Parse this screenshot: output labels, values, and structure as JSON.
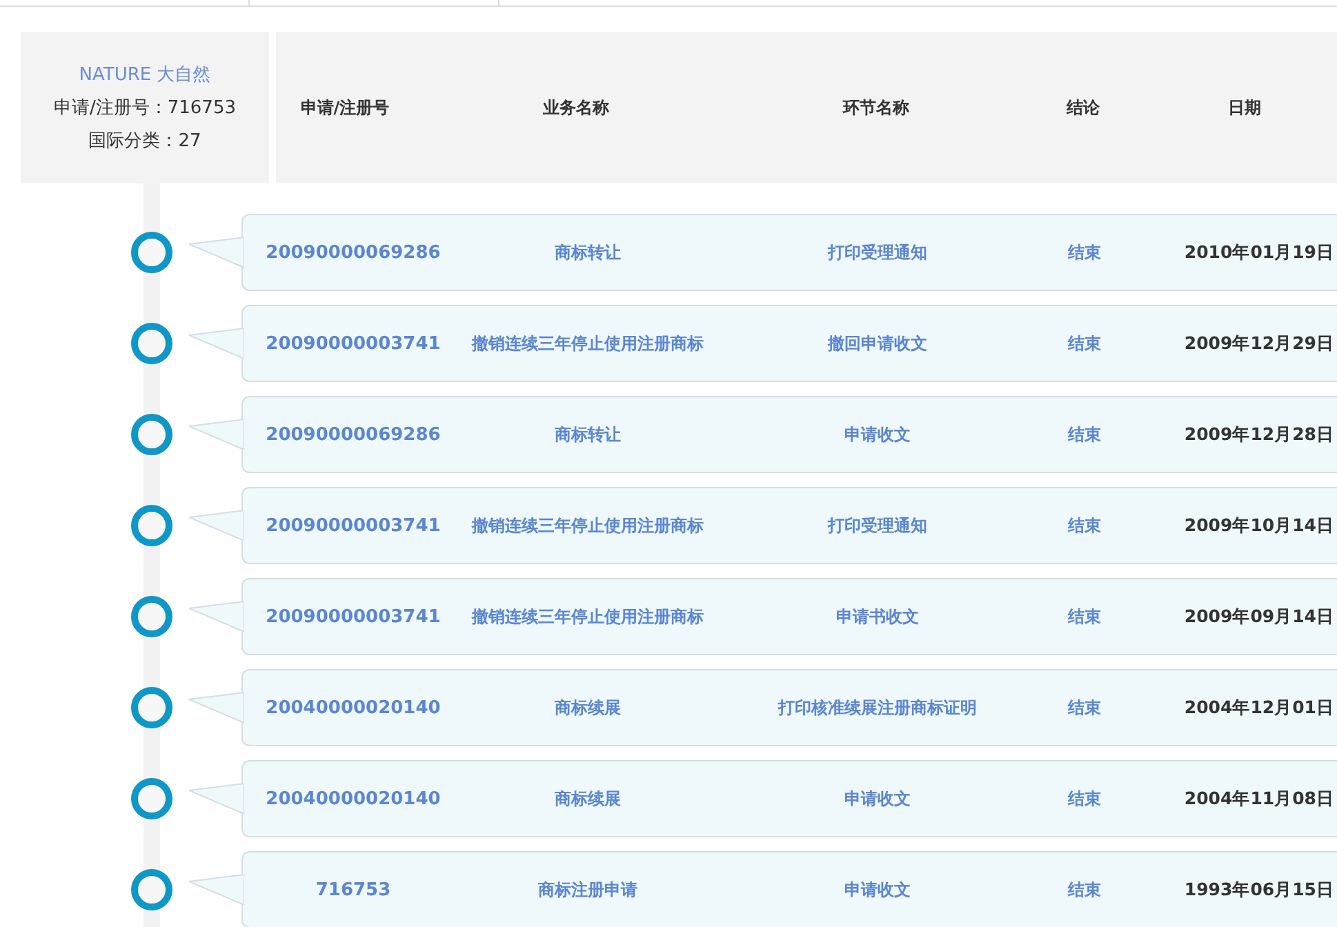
{
  "info": {
    "title": "NATURE 大自然",
    "reg_no": "申请/注册号：716753",
    "class": "国际分类：27"
  },
  "columns": [
    "申请/注册号",
    "业务名称",
    "环节名称",
    "结论",
    "日期"
  ],
  "rows": [
    {
      "reg_no": "20090000069286",
      "business": "商标转让",
      "step": "打印受理通知",
      "conclusion": "结束",
      "date": "2010年01月19日"
    },
    {
      "reg_no": "20090000003741",
      "business": "撤销连续三年停止使用注册商标",
      "step": "撤回申请收文",
      "conclusion": "结束",
      "date": "2009年12月29日"
    },
    {
      "reg_no": "20090000069286",
      "business": "商标转让",
      "step": "申请收文",
      "conclusion": "结束",
      "date": "2009年12月28日"
    },
    {
      "reg_no": "20090000003741",
      "business": "撤销连续三年停止使用注册商标",
      "step": "打印受理通知",
      "conclusion": "结束",
      "date": "2009年10月14日"
    },
    {
      "reg_no": "20090000003741",
      "business": "撤销连续三年停止使用注册商标",
      "step": "申请书收文",
      "conclusion": "结束",
      "date": "2009年09月14日"
    },
    {
      "reg_no": "20040000020140",
      "business": "商标续展",
      "step": "打印核准续展注册商标证明",
      "conclusion": "结束",
      "date": "2004年12月01日"
    },
    {
      "reg_no": "20040000020140",
      "business": "商标续展",
      "step": "申请收文",
      "conclusion": "结束",
      "date": "2004年11月08日"
    },
    {
      "reg_no": "716753",
      "business": "商标注册申请",
      "step": "申请收文",
      "conclusion": "结束",
      "date": "1993年06月15日"
    }
  ]
}
